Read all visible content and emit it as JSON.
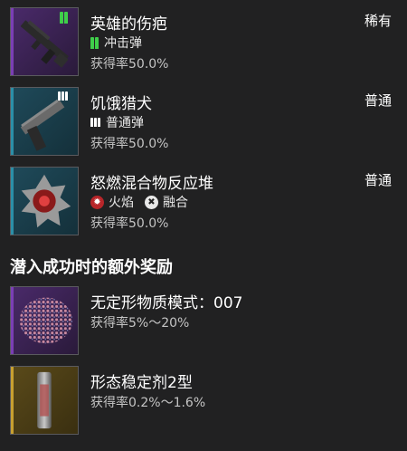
{
  "items": [
    {
      "title": "英雄的伤疤",
      "rarity": "稀有",
      "sub": "冲击弹",
      "rate": "获得率50.0%"
    },
    {
      "title": "饥饿猎犬",
      "rarity": "普通",
      "sub": "普通弹",
      "rate": "获得率50.0%"
    },
    {
      "title": "怒燃混合物反应堆",
      "rarity": "普通",
      "sub_a": "火焰",
      "sub_b": "融合",
      "rate": "获得率50.0%"
    }
  ],
  "bonus_section": {
    "title": "潜入成功时的额外奖励",
    "items": [
      {
        "title": "无定形物质模式：007",
        "rate": "获得率5%～20%"
      },
      {
        "title": "形态稳定剂2型",
        "rate": "获得率0.2%～1.6%"
      }
    ]
  },
  "colors": {
    "rare": "#7b3fb5",
    "common": "#2b8fa8",
    "ammo_impact": "#3fcf4a",
    "fire": "#b8262a"
  }
}
